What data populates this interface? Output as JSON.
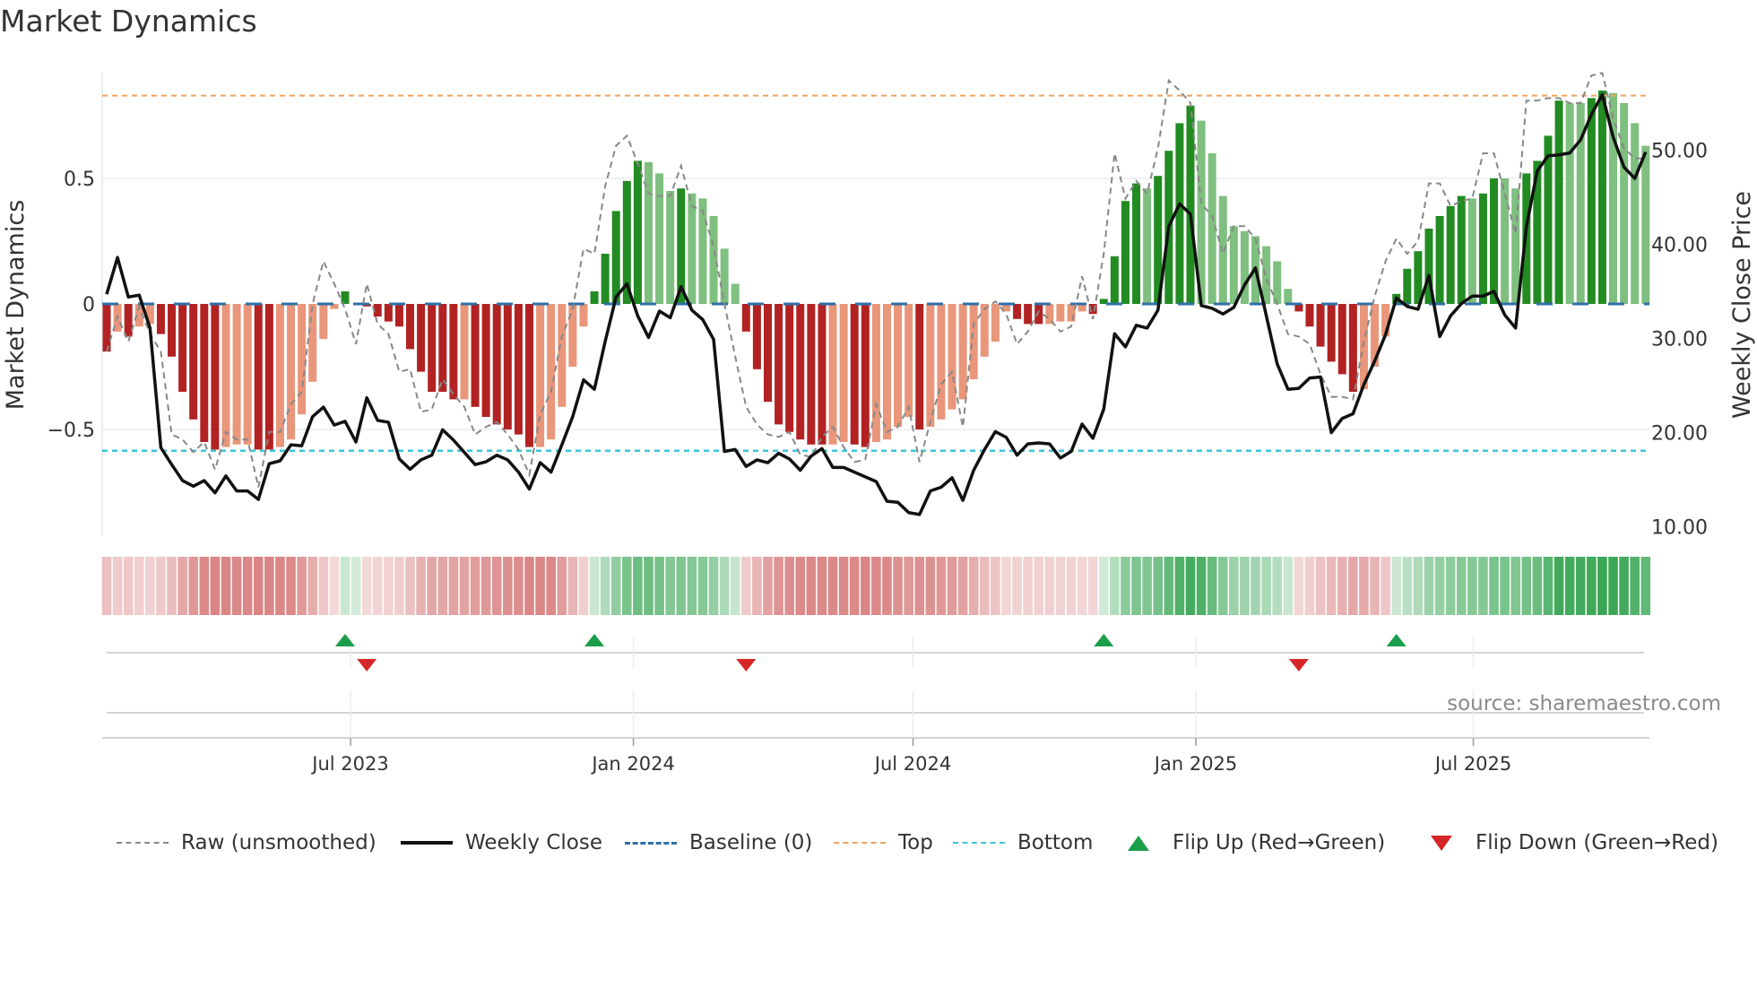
{
  "title": "Market Dynamics",
  "source": "source: sharemaestro.com",
  "legend": {
    "raw": "Raw (unsmoothed)",
    "close": "Weekly Close",
    "baseline": "Baseline (0)",
    "top": "Top",
    "bottom": "Bottom",
    "flip_up": "Flip Up (Red→Green)",
    "flip_down": "Flip Down (Green→Red)"
  },
  "colors": {
    "pos_strong": "#228b22",
    "pos_weak": "#7fbf7f",
    "neg_strong": "#b22222",
    "neg_weak": "#e9967a",
    "raw": "#888888",
    "close": "#111111",
    "baseline": "#2e6fa8",
    "top": "#f0a35e",
    "bottom": "#3cc5d8",
    "flip_up": "#1a9e4a",
    "flip_down": "#d62728",
    "strip_pos": "#3aa655",
    "strip_neg": "#cd5c5c"
  },
  "chart_data": {
    "type": "bar",
    "title": "Market Dynamics",
    "ylabel": "Market Dynamics",
    "y2label": "Weekly Close Price",
    "ylim": [
      -0.95,
      0.93
    ],
    "y2lim": [
      8.5,
      58.3
    ],
    "yticks": [
      {
        "v": 0.5,
        "label": "0.5"
      },
      {
        "v": 0,
        "label": "0"
      },
      {
        "v": -0.5,
        "label": "−0.5"
      }
    ],
    "y2ticks": [
      {
        "v": 50,
        "label": "50.00"
      },
      {
        "v": 40,
        "label": "40.00"
      },
      {
        "v": 30,
        "label": "30.00"
      },
      {
        "v": 20,
        "label": "20.00"
      },
      {
        "v": 10,
        "label": "10.00"
      }
    ],
    "xticks": [
      {
        "at": 22.5,
        "label": "Jul 2023"
      },
      {
        "at": 48.6,
        "label": "Jan 2024"
      },
      {
        "at": 74.4,
        "label": "Jul 2024"
      },
      {
        "at": 100.5,
        "label": "Jan 2025"
      },
      {
        "at": 126.1,
        "label": "Jul 2025"
      }
    ],
    "top_level": 0.83,
    "bottom_level": -0.585,
    "baseline": 0,
    "values": [
      -0.19,
      -0.11,
      -0.13,
      -0.09,
      -0.08,
      -0.12,
      -0.21,
      -0.35,
      -0.46,
      -0.55,
      -0.58,
      -0.57,
      -0.56,
      -0.56,
      -0.58,
      -0.58,
      -0.57,
      -0.54,
      -0.44,
      -0.31,
      -0.14,
      -0.02,
      0.05,
      0.0,
      -0.01,
      -0.05,
      -0.07,
      -0.09,
      -0.18,
      -0.27,
      -0.35,
      -0.35,
      -0.38,
      -0.38,
      -0.41,
      -0.45,
      -0.48,
      -0.5,
      -0.52,
      -0.57,
      -0.57,
      -0.54,
      -0.41,
      -0.25,
      -0.09,
      0.05,
      0.2,
      0.37,
      0.49,
      0.57,
      0.565,
      0.52,
      0.45,
      0.46,
      0.44,
      0.42,
      0.35,
      0.22,
      0.08,
      -0.11,
      -0.26,
      -0.39,
      -0.48,
      -0.51,
      -0.54,
      -0.56,
      -0.56,
      -0.56,
      -0.55,
      -0.56,
      -0.57,
      -0.55,
      -0.54,
      -0.49,
      -0.45,
      -0.5,
      -0.49,
      -0.46,
      -0.42,
      -0.38,
      -0.3,
      -0.21,
      -0.15,
      -0.03,
      -0.06,
      -0.08,
      -0.08,
      -0.08,
      -0.07,
      -0.07,
      -0.03,
      -0.04,
      0.02,
      0.19,
      0.41,
      0.48,
      0.46,
      0.51,
      0.61,
      0.72,
      0.79,
      0.73,
      0.6,
      0.43,
      0.31,
      0.29,
      0.27,
      0.23,
      0.17,
      0.06,
      -0.03,
      -0.09,
      -0.17,
      -0.23,
      -0.28,
      -0.35,
      -0.34,
      -0.25,
      -0.13,
      0.04,
      0.14,
      0.21,
      0.3,
      0.35,
      0.39,
      0.43,
      0.42,
      0.44,
      0.5,
      0.5,
      0.46,
      0.52,
      0.57,
      0.67,
      0.81,
      0.8,
      0.8,
      0.82,
      0.85,
      0.84,
      0.8,
      0.72,
      0.63
    ],
    "strength": [
      "S",
      "W",
      "S",
      "W",
      "W",
      "S",
      "S",
      "S",
      "S",
      "S",
      "S",
      "W",
      "W",
      "W",
      "S",
      "S",
      "W",
      "W",
      "W",
      "W",
      "W",
      "W",
      "S",
      "W",
      "S",
      "S",
      "S",
      "S",
      "S",
      "S",
      "S",
      "S",
      "S",
      "W",
      "S",
      "S",
      "S",
      "S",
      "S",
      "S",
      "W",
      "W",
      "W",
      "W",
      "W",
      "S",
      "S",
      "S",
      "S",
      "S",
      "W",
      "W",
      "W",
      "S",
      "W",
      "W",
      "W",
      "W",
      "W",
      "S",
      "S",
      "S",
      "S",
      "S",
      "S",
      "S",
      "S",
      "W",
      "W",
      "S",
      "S",
      "W",
      "W",
      "W",
      "W",
      "S",
      "W",
      "W",
      "W",
      "W",
      "W",
      "W",
      "W",
      "W",
      "S",
      "S",
      "S",
      "W",
      "W",
      "W",
      "W",
      "S",
      "S",
      "S",
      "S",
      "S",
      "W",
      "S",
      "S",
      "S",
      "S",
      "W",
      "W",
      "W",
      "W",
      "W",
      "W",
      "W",
      "W",
      "W",
      "S",
      "S",
      "S",
      "S",
      "S",
      "S",
      "W",
      "W",
      "W",
      "S",
      "S",
      "S",
      "S",
      "S",
      "S",
      "S",
      "W",
      "S",
      "S",
      "W",
      "W",
      "S",
      "S",
      "S",
      "S",
      "W",
      "W",
      "S",
      "S",
      "W",
      "W",
      "W",
      "W"
    ],
    "raw": [
      -0.19,
      -0.05,
      -0.15,
      -0.01,
      -0.12,
      -0.19,
      -0.52,
      -0.54,
      -0.59,
      -0.55,
      -0.66,
      -0.51,
      -0.54,
      -0.54,
      -0.73,
      -0.51,
      -0.51,
      -0.4,
      -0.35,
      0.0,
      0.17,
      0.08,
      -0.02,
      -0.16,
      0.08,
      -0.08,
      -0.12,
      -0.27,
      -0.26,
      -0.43,
      -0.42,
      -0.3,
      -0.36,
      -0.41,
      -0.52,
      -0.49,
      -0.47,
      -0.52,
      -0.58,
      -0.68,
      -0.44,
      -0.35,
      -0.13,
      -0.02,
      0.22,
      0.2,
      0.47,
      0.63,
      0.67,
      0.56,
      0.44,
      0.43,
      0.43,
      0.55,
      0.39,
      0.37,
      0.23,
      0.0,
      -0.21,
      -0.41,
      -0.48,
      -0.52,
      -0.53,
      -0.51,
      -0.6,
      -0.61,
      -0.53,
      -0.49,
      -0.57,
      -0.63,
      -0.62,
      -0.4,
      -0.51,
      -0.49,
      -0.41,
      -0.63,
      -0.47,
      -0.32,
      -0.27,
      -0.49,
      -0.08,
      -0.02,
      0.01,
      -0.04,
      -0.16,
      -0.11,
      -0.03,
      -0.06,
      -0.11,
      -0.09,
      0.11,
      -0.06,
      0.2,
      0.6,
      0.42,
      0.49,
      0.44,
      0.62,
      0.89,
      0.85,
      0.8,
      0.4,
      0.35,
      0.2,
      0.31,
      0.31,
      0.26,
      0.1,
      0.0,
      -0.12,
      -0.13,
      -0.16,
      -0.28,
      -0.37,
      -0.37,
      -0.38,
      -0.15,
      0.03,
      0.17,
      0.26,
      0.2,
      0.25,
      0.48,
      0.48,
      0.39,
      0.41,
      0.42,
      0.6,
      0.6,
      0.44,
      0.28,
      0.81,
      0.81,
      0.82,
      0.82,
      0.8,
      0.8,
      0.91,
      0.92,
      0.74,
      0.62,
      0.58,
      0.58
    ],
    "close": [
      34.7,
      38.6,
      34.4,
      34.6,
      31.1,
      18.4,
      16.6,
      14.9,
      14.3,
      14.9,
      13.6,
      15.4,
      13.8,
      13.8,
      12.9,
      16.7,
      17.0,
      18.7,
      18.6,
      21.7,
      22.7,
      20.8,
      21.2,
      19.0,
      23.7,
      21.3,
      21.1,
      17.2,
      16.1,
      17.1,
      17.6,
      20.3,
      19.2,
      17.9,
      16.6,
      16.9,
      17.6,
      17.1,
      15.8,
      14.0,
      16.8,
      15.8,
      18.7,
      21.7,
      25.6,
      24.6,
      29.7,
      34.4,
      35.8,
      32.4,
      30.1,
      32.9,
      32.2,
      35.5,
      33.0,
      32.0,
      29.9,
      18.0,
      18.2,
      16.4,
      17.1,
      16.8,
      17.8,
      17.2,
      16.0,
      17.5,
      18.3,
      16.3,
      16.3,
      15.8,
      15.3,
      14.8,
      12.7,
      12.6,
      11.5,
      11.3,
      13.8,
      14.2,
      15.2,
      12.8,
      16.0,
      18.2,
      20.1,
      19.5,
      17.6,
      18.8,
      18.9,
      18.8,
      17.3,
      18.0,
      20.9,
      19.4,
      22.5,
      30.5,
      29.1,
      31.4,
      31.1,
      33.0,
      41.9,
      44.3,
      43.2,
      33.5,
      33.2,
      32.6,
      33.3,
      35.7,
      37.5,
      32.4,
      27.3,
      24.6,
      24.7,
      25.8,
      25.9,
      20.0,
      21.5,
      22.0,
      25.1,
      27.6,
      30.4,
      34.3,
      33.4,
      33.1,
      36.7,
      30.2,
      32.4,
      33.7,
      34.5,
      34.5,
      35.0,
      32.5,
      31.1,
      41.9,
      47.8,
      49.4,
      49.5,
      49.7,
      51.1,
      53.8,
      55.9,
      51.4,
      48.2,
      47.0,
      49.8
    ],
    "flip_up_index": [
      22,
      45,
      92,
      119
    ],
    "flip_down_index": [
      24,
      59,
      110
    ]
  }
}
